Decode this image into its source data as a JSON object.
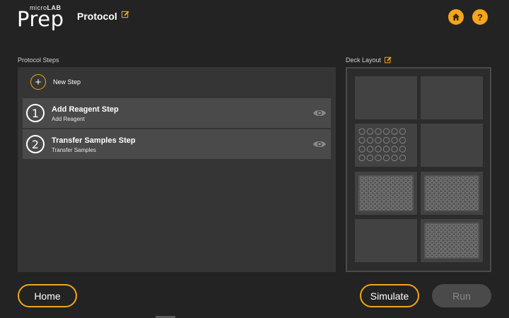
{
  "header": {
    "logo_small_prefix": "micro",
    "logo_small_bold": "LAB",
    "logo_big": "Prep",
    "title": "Protocol",
    "home_icon": "home-icon",
    "help_label": "?"
  },
  "steps": {
    "section_label": "Protocol Steps",
    "new_step_label": "New Step",
    "items": [
      {
        "number": "1",
        "title": "Add Reagent Step",
        "subtitle": "Add Reagent"
      },
      {
        "number": "2",
        "title": "Transfer Samples Step",
        "subtitle": "Transfer Samples"
      }
    ]
  },
  "deck": {
    "section_label": "Deck Layout",
    "slots": [
      {
        "content": "empty"
      },
      {
        "content": "empty"
      },
      {
        "content": "24-well plate"
      },
      {
        "content": "empty"
      },
      {
        "content": "96-well plate"
      },
      {
        "content": "96-well plate"
      },
      {
        "content": "empty"
      },
      {
        "content": "96-well plate"
      }
    ]
  },
  "footer": {
    "home_label": "Home",
    "simulate_label": "Simulate",
    "run_label": "Run"
  },
  "colors": {
    "accent": "#f4a51c",
    "background": "#232323",
    "panel": "#353535",
    "row": "#4a4a4a",
    "disabled_text": "#8a8a8a"
  }
}
